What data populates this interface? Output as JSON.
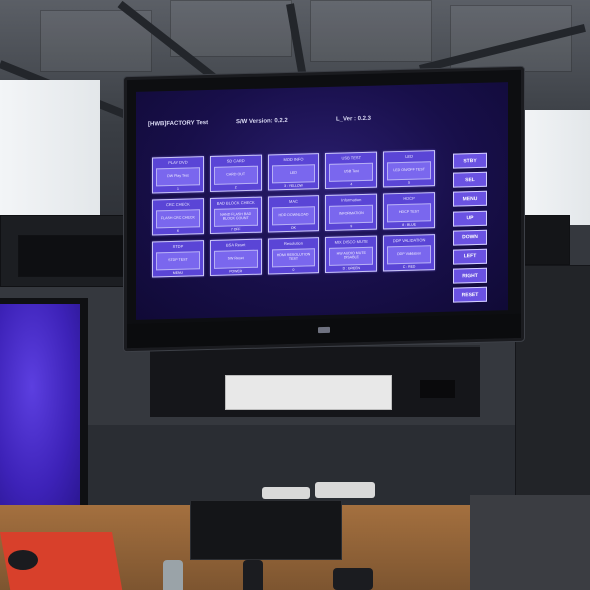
{
  "tv_screen": {
    "header": {
      "title": "[HWB]FACTORY Test",
      "sw_version": "S/W Version: 0.2.2",
      "l_version": "L_Ver : 0.2.3"
    },
    "menu": [
      {
        "title": "PLAY DVD",
        "body": "DW Play Test",
        "key": "1"
      },
      {
        "title": "SD CARD",
        "body": "CARD OUT",
        "key": "2"
      },
      {
        "title": "MOD INFO",
        "body": "LED",
        "key": "3 : YELLOW"
      },
      {
        "title": "USB TEST",
        "body": "USB Test",
        "key": "4"
      },
      {
        "title": "LED",
        "body": "LED ON/OFF TEST",
        "key": "5"
      },
      {
        "title": "CRC CHECK",
        "body": "FLASH CRC CHECK",
        "key": "6"
      },
      {
        "title": "BAD BLOCK CHECK",
        "body": "NAND FLASH BAD BLOCK COUNT",
        "key": "7 OFF"
      },
      {
        "title": "MAC",
        "body": "HDD DOWNLOAD",
        "key": "OK"
      },
      {
        "title": "Information",
        "body": "INFORMATION",
        "key": "9"
      },
      {
        "title": "HDCP",
        "body": "HDCP TEST",
        "key": "8 : BLUE"
      },
      {
        "title": "STDP",
        "body": "STDP TEST",
        "key": "MENU"
      },
      {
        "title": "BSA Reset",
        "body": "SW Reset",
        "key": "POWER"
      },
      {
        "title": "Resolution",
        "body": "HDMI RESOLUTION TEST",
        "key": "0"
      },
      {
        "title": "MIX DISCO MUTE",
        "body": "HW AUDIO MUTE DISABLE",
        "key": "D : GREEN"
      },
      {
        "title": "DDP VALIDATION",
        "body": "DDP Validation",
        "key": "C : RED"
      }
    ],
    "side_buttons": [
      "STBY",
      "SEL",
      "MENU",
      "UP",
      "DOWN",
      "LEFT",
      "RIGHT",
      "RESET"
    ]
  },
  "colors": {
    "screen_bg": "#180f4a",
    "card_bg": "#5a45d6",
    "card_body": "#7a67ee",
    "side_button": "#6a52e2",
    "left_monitor": "#3d22b8"
  }
}
